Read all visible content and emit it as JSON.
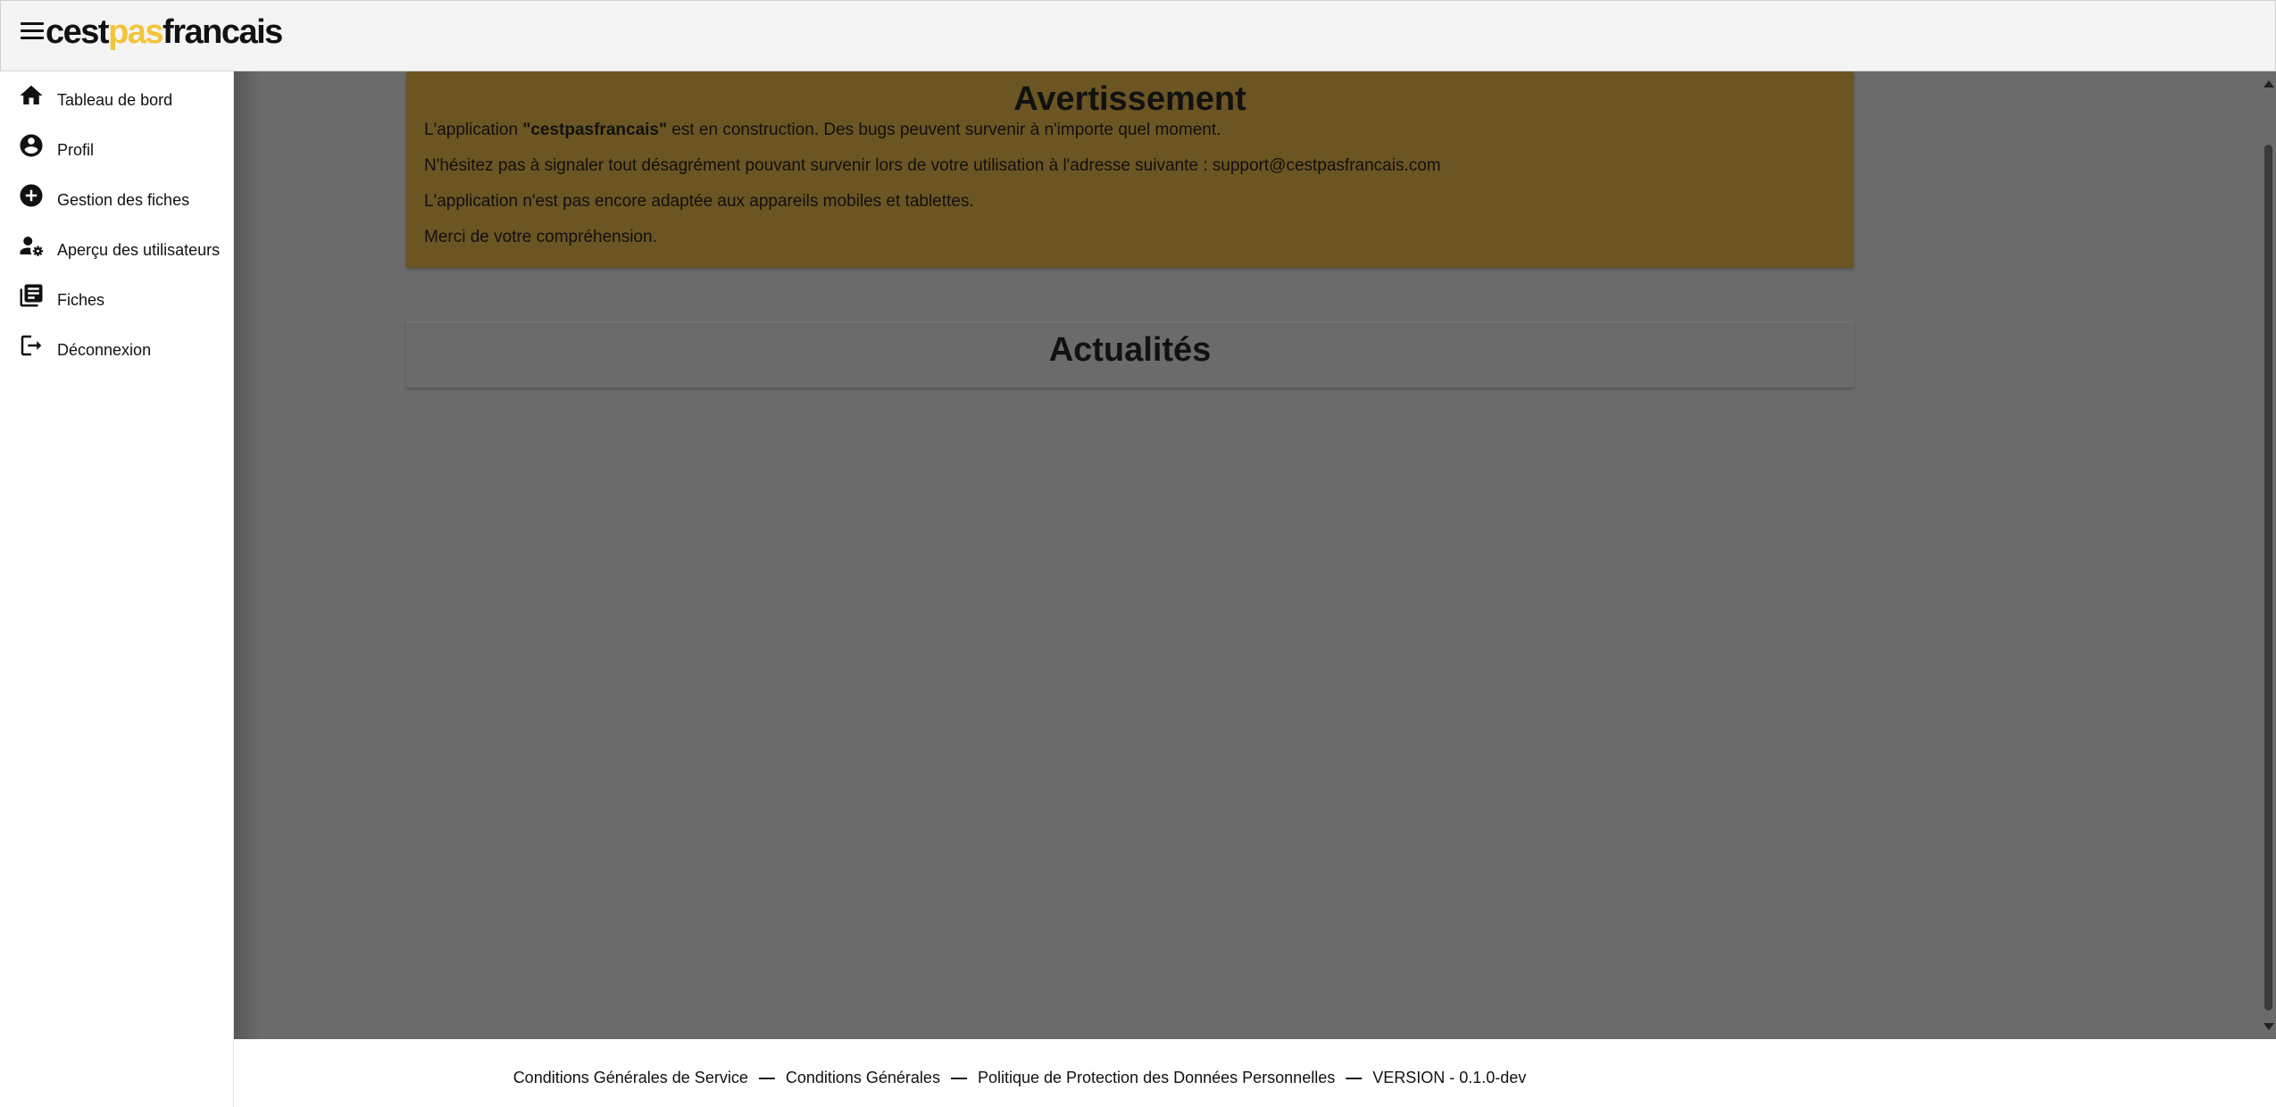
{
  "header": {
    "logo_part1": "cest",
    "logo_part2": "pas",
    "logo_part3": "francais"
  },
  "sidebar": {
    "items": [
      {
        "label": "Tableau de bord",
        "icon": "home-icon"
      },
      {
        "label": "Profil",
        "icon": "account-circle-icon"
      },
      {
        "label": "Gestion des fiches",
        "icon": "add-circle-icon"
      },
      {
        "label": "Aperçu des utilisateurs",
        "icon": "user-settings-icon"
      },
      {
        "label": "Fiches",
        "icon": "library-books-icon"
      },
      {
        "label": "Déconnexion",
        "icon": "logout-icon"
      }
    ]
  },
  "warning": {
    "title": "Avertissement",
    "line1_prefix": "L'application ",
    "line1_bold": "\"cestpasfrancais\"",
    "line1_suffix": " est en construction. Des bugs peuvent survenir à n'importe quel moment.",
    "line2": "N'hésitez pas à signaler tout désagrément pouvant survenir lors de votre utilisation à l'adresse suivante : support@cestpasfrancais.com",
    "line3": "L'application n'est pas encore adaptée aux appareils mobiles et tablettes.",
    "line4": "Merci de votre compréhension."
  },
  "news": {
    "title": "Actualités"
  },
  "footer": {
    "link1": "Conditions Générales de Service",
    "link2": "Conditions Générales",
    "link3": "Politique de Protection des Données Personnelles",
    "version": "VERSION - 0.1.0-dev",
    "separator": "—"
  },
  "colors": {
    "brand_yellow": "#f2c43a",
    "warning_bg": "#6b5522",
    "overlay_bg": "#6b6b6b"
  }
}
